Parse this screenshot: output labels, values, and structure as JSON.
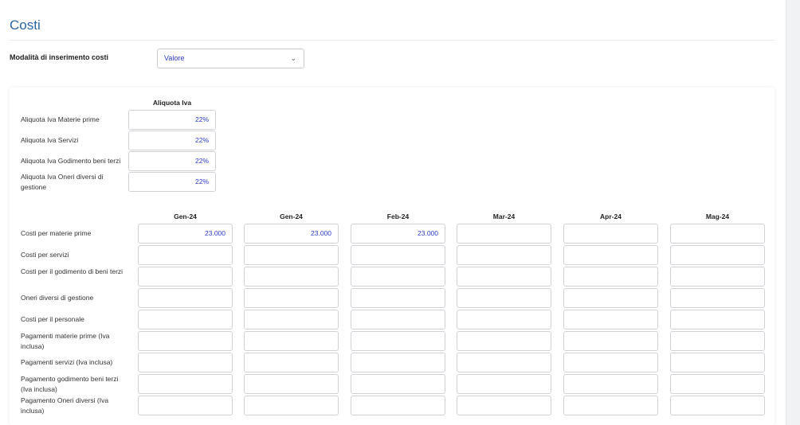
{
  "page": {
    "title": "Costi"
  },
  "mode": {
    "label": "Modalità di inserimento costi",
    "value": "Valore"
  },
  "vat": {
    "header": "Aliquota Iva",
    "rows": [
      {
        "label": "Aliquota Iva Materie prime",
        "value": "22%"
      },
      {
        "label": "Aliquota Iva Servizi",
        "value": "22%"
      },
      {
        "label": "Aliquota Iva Godimento beni terzi",
        "value": "22%"
      },
      {
        "label": "Aliquota Iva Oneri diversi di gestione",
        "value": "22%"
      }
    ]
  },
  "costs": {
    "months": [
      "Gen-24",
      "Gen-24",
      "Feb-24",
      "Mar-24",
      "Apr-24",
      "Mag-24"
    ],
    "rows": [
      {
        "label": "Costi per materie prime",
        "values": [
          "23.000",
          "23.000",
          "23.000",
          "",
          "",
          ""
        ]
      },
      {
        "label": "Costi per servizi",
        "values": [
          "",
          "",
          "",
          "",
          "",
          ""
        ]
      },
      {
        "label": "Costi per il godimento di beni terzi",
        "values": [
          "",
          "",
          "",
          "",
          "",
          ""
        ]
      },
      {
        "label": "Oneri diversi di gestione",
        "values": [
          "",
          "",
          "",
          "",
          "",
          ""
        ]
      },
      {
        "label": "Costi per il personale",
        "values": [
          "",
          "",
          "",
          "",
          "",
          ""
        ]
      },
      {
        "label": "Pagamenti materie prime (Iva inclusa)",
        "values": [
          "",
          "",
          "",
          "",
          "",
          ""
        ]
      },
      {
        "label": "Pagamenti servizi (Iva inclusa)",
        "values": [
          "",
          "",
          "",
          "",
          "",
          ""
        ]
      },
      {
        "label": "Pagamento godimento beni terzi (Iva inclusa)",
        "values": [
          "",
          "",
          "",
          "",
          "",
          ""
        ]
      },
      {
        "label": "Pagamento Oneri diversi (Iva inclusa)",
        "values": [
          "",
          "",
          "",
          "",
          "",
          ""
        ]
      }
    ]
  }
}
